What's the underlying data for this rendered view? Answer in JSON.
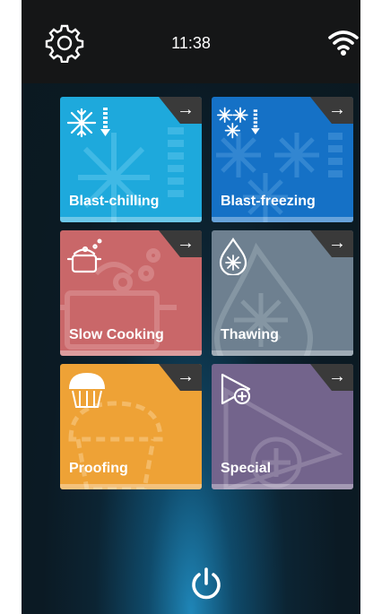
{
  "status_bar": {
    "time": "11:38",
    "settings_icon": "gear-icon",
    "connectivity_icon": "wifi-icon"
  },
  "tiles": [
    {
      "label": "Blast-chilling",
      "color": "#1ea9dc",
      "icon": "snowflake-thermometer-icon"
    },
    {
      "label": "Blast-freezing",
      "color": "#1571c6",
      "icon": "three-snowflakes-thermometer-icon"
    },
    {
      "label": "Slow Cooking",
      "color": "#c96769",
      "icon": "cooking-pot-icon"
    },
    {
      "label": "Thawing",
      "color": "#6e8090",
      "icon": "droplet-snowflake-icon"
    },
    {
      "label": "Proofing",
      "color": "#eea236",
      "icon": "muffin-icon"
    },
    {
      "label": "Special",
      "color": "#73648c",
      "icon": "play-plus-icon"
    }
  ],
  "tile_arrow": "→",
  "power_icon": "power-icon",
  "colors": {
    "status_bar": "#151617",
    "background": "#0b1a24",
    "accent_glow": "#1f86b8"
  }
}
